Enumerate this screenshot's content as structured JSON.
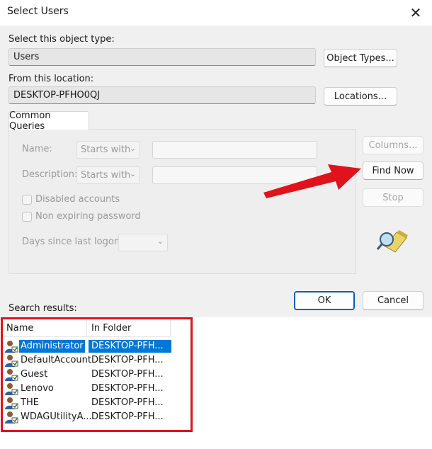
{
  "window": {
    "title": "Select Users",
    "close_glyph": "✕"
  },
  "object_type": {
    "label": "Select this object type:",
    "value": "Users",
    "button": "Object Types..."
  },
  "location": {
    "label": "From this location:",
    "value": "DESKTOP-PFHO0QJ",
    "button": "Locations..."
  },
  "queries": {
    "tab": "Common Queries",
    "name_label": "Name:",
    "name_mode": "Starts with",
    "description_label": "Description:",
    "description_mode": "Starts with",
    "disabled_accounts": "Disabled accounts",
    "non_expiring": "Non expiring password",
    "days_label": "Days since last logon:"
  },
  "side_buttons": {
    "columns": "Columns...",
    "find_now": "Find Now",
    "stop": "Stop"
  },
  "dialog_buttons": {
    "ok": "OK",
    "cancel": "Cancel"
  },
  "results": {
    "label": "Search results:",
    "columns": [
      "Name",
      "In Folder"
    ],
    "rows": [
      {
        "name": "Administrator",
        "folder": "DESKTOP-PFH...",
        "selected": true
      },
      {
        "name": "DefaultAccount",
        "folder": "DESKTOP-PFH..."
      },
      {
        "name": "Guest",
        "folder": "DESKTOP-PFH..."
      },
      {
        "name": "Lenovo",
        "folder": "DESKTOP-PFH..."
      },
      {
        "name": "THE",
        "folder": "DESKTOP-PFH..."
      },
      {
        "name": "WDAGUtilityA...",
        "folder": "DESKTOP-PFH..."
      }
    ]
  },
  "icons": {
    "search_flashlight": "flashlight-search-icon",
    "user": "user-icon",
    "annotation_arrow": "red-arrow-icon",
    "arrow_color": "#e0121b",
    "selection_color": "#0078d7"
  }
}
